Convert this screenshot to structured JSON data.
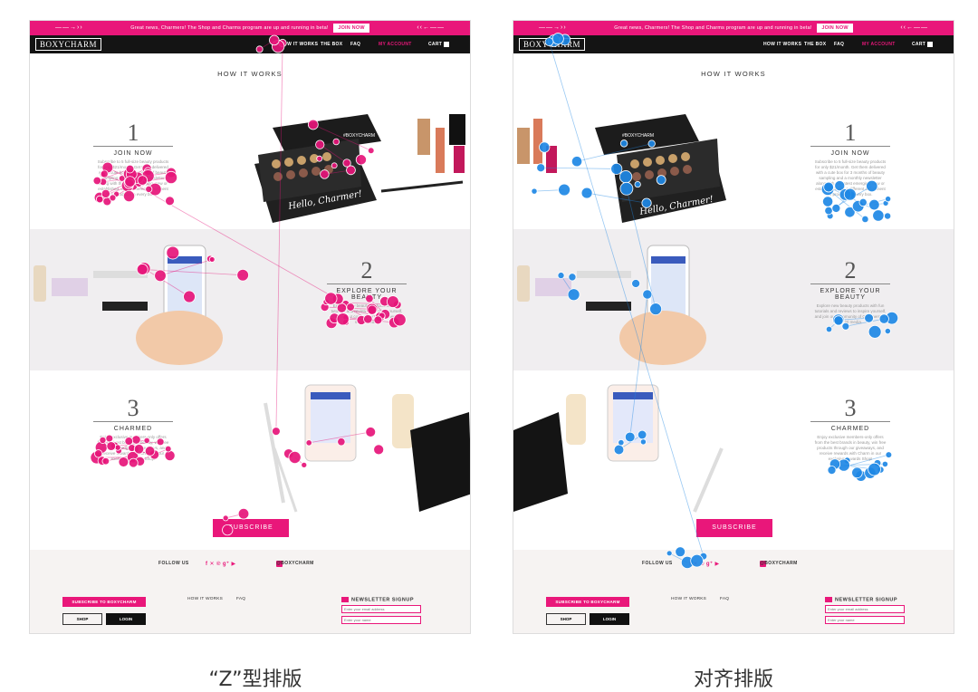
{
  "topbar": {
    "message": "Great news, Charmers! The Shop and Charms program are up and running in beta!",
    "join": "JOIN NOW",
    "left_arrow": "——→››",
    "right_arrow": "‹‹←——"
  },
  "navbar": {
    "logo": "BOXYCHARM",
    "how_it_works": "HOW IT WORKS",
    "the_box": "THE BOX",
    "faq": "FAQ",
    "my_account": "MY ACCOUNT",
    "cart": "CART",
    "cart_count": "0"
  },
  "how_it_works": "HOW IT WORKS",
  "photo_text": {
    "box_logo": "#BOXYCHARM",
    "hello": "Hello, Charmer!",
    "palette": "OFRA"
  },
  "steps": [
    {
      "num": "1",
      "title": "JOIN NOW",
      "desc": "Subscribe to 5 full-size beauty products for only $21/month. Get them delivered with a cute box for 3 months of beauty sampling and a monthly newsletter along with the latest emerging, new or established, and a different assortment of products in every box."
    },
    {
      "num": "2",
      "title": "EXPLORE YOUR BEAUTY",
      "desc": "Explore new beauty products with fun tutorials and reviews to inspire yourself, and join our community of Charmers on social media."
    },
    {
      "num": "3",
      "title": "CHARMED",
      "desc": "Enjoy exclusive members-only offers from the best brands in beauty, win free products through our giveaways, and receive rewards with Charm in our exclusive rewards Shop!"
    }
  ],
  "subscribe": "SUBSCRIBE",
  "footer": {
    "follow_us": "FOLLOW US",
    "social_icons": "f  ✕  ℗  g⁺  ▶",
    "handle": "@BOXYCHARM",
    "subscribe_btn": "SUBSCRIBE TO BOXYCHARM",
    "shop": "SHOP",
    "login": "LOGIN",
    "how_it_works": "HOW IT WORKS",
    "faq": "FAQ",
    "newsletter": "NEWSLETTER SIGNUP",
    "email_placeholder": "Enter your email address",
    "name_placeholder": "Enter your name"
  },
  "captions": {
    "left": "“Z”型排版",
    "right": "对齐排版"
  },
  "colors": {
    "brand_pink": "#e9177a",
    "heat_left": "#e6157a",
    "heat_right": "#1e88e5"
  }
}
